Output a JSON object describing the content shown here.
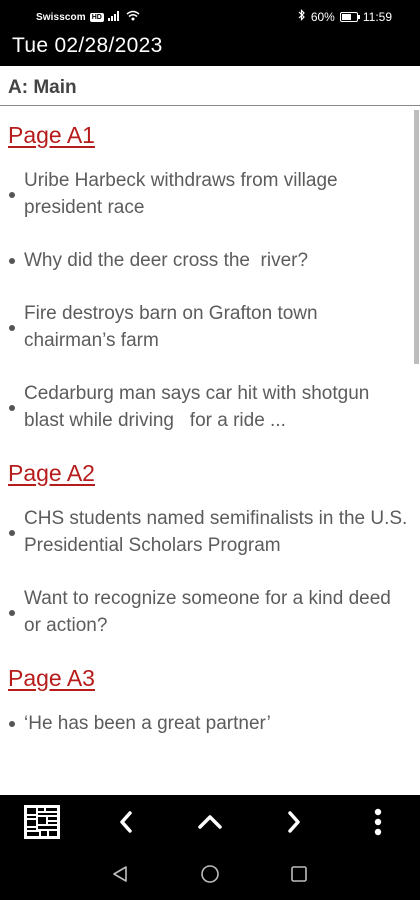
{
  "status_bar": {
    "carrier": "Swisscom",
    "network_badge": "HD",
    "battery": "60%",
    "time": "11:59",
    "icons": [
      "signal-icon",
      "wifi-icon",
      "bluetooth-icon",
      "battery-icon"
    ]
  },
  "app": {
    "date_title": "Tue 02/28/2023"
  },
  "section": {
    "title": "A: Main"
  },
  "pages": [
    {
      "label": "Page A1",
      "articles": [
        "Uribe Harbeck withdraws from village president race",
        "Why did the deer cross the  river?",
        "Fire destroys barn on Grafton town chairman’s farm",
        "Cedarburg man says car hit with shotgun blast while driving   for a ride ..."
      ]
    },
    {
      "label": "Page A2",
      "articles": [
        "CHS students named semifinalists in the U.S. Presidential Scholars Program",
        "Want to recognize someone for a kind deed or action?"
      ]
    },
    {
      "label": "Page A3",
      "articles": [
        "‘He has been a great partner’"
      ]
    }
  ],
  "toolbar": {
    "icons": [
      "page-grid-icon",
      "chevron-left-icon",
      "chevron-up-icon",
      "chevron-right-icon",
      "more-vertical-icon"
    ]
  },
  "system_nav": {
    "icons": [
      "back-triangle-icon",
      "home-circle-icon",
      "recents-square-icon"
    ]
  },
  "colors": {
    "link": "#b71c1c",
    "article_text": "#5c5c5c",
    "bars": "#000000"
  }
}
